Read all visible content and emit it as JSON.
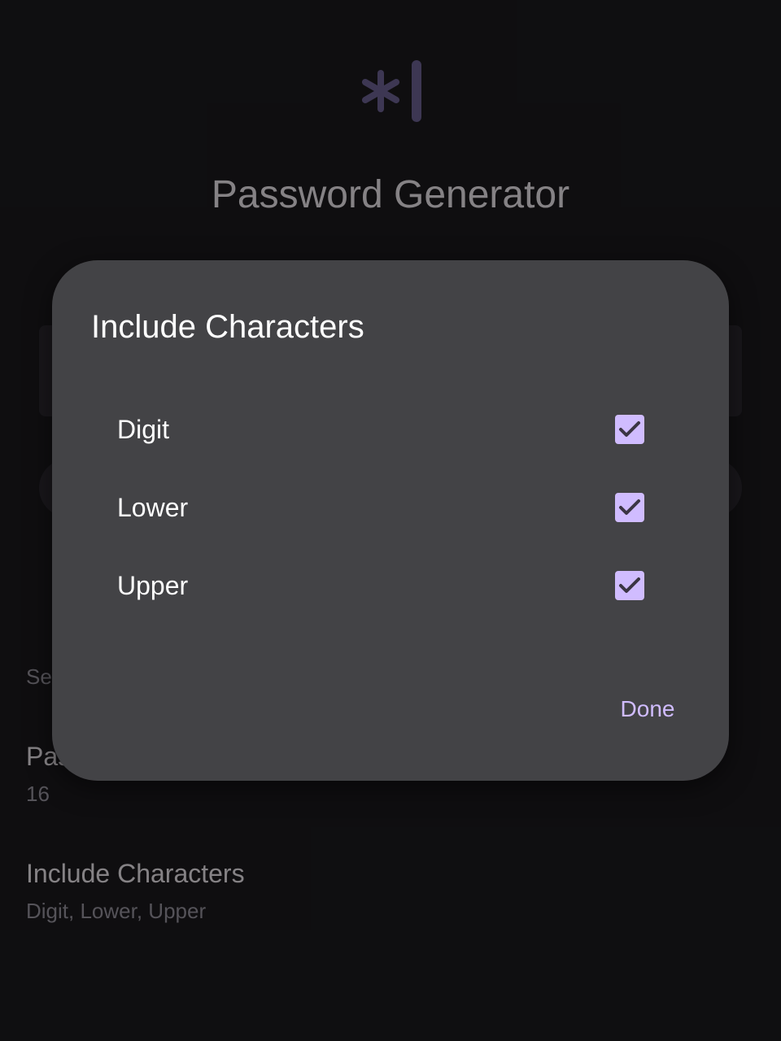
{
  "app": {
    "title": "Password Generator",
    "logo_icon": "asterisk-cursor-icon",
    "accent_color": "#6a5f8f"
  },
  "settings": {
    "header": "Settings",
    "password_length": {
      "title": "Password Length",
      "value": "16"
    },
    "include_characters": {
      "title": "Include Characters",
      "value": "Digit, Lower, Upper"
    }
  },
  "dialog": {
    "title": "Include Characters",
    "options": [
      {
        "label": "Digit",
        "checked": true
      },
      {
        "label": "Lower",
        "checked": true
      },
      {
        "label": "Upper",
        "checked": true
      }
    ],
    "done_label": "Done",
    "checkbox_color": "#d0bcff"
  }
}
